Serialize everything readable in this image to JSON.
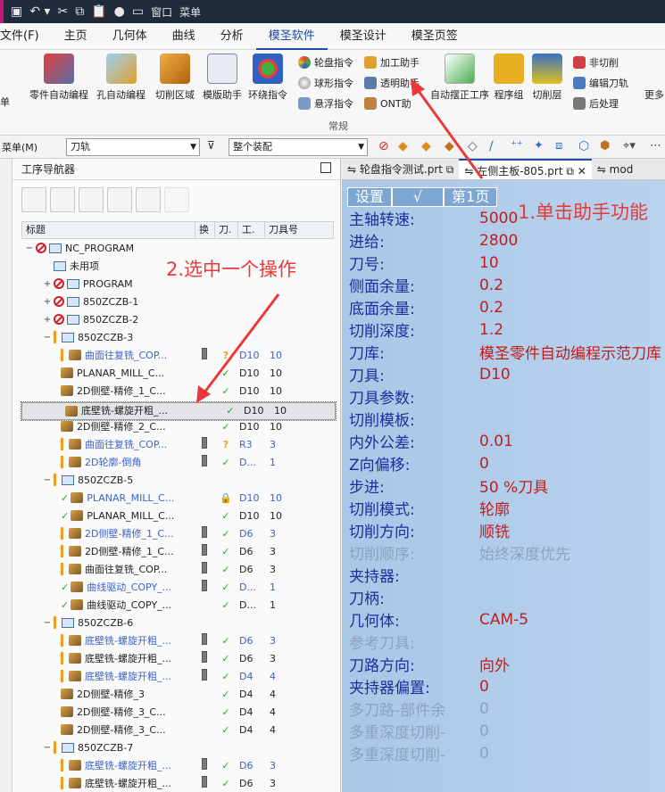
{
  "menubar": [
    "文件(F)",
    "主页",
    "几何体",
    "曲线",
    "分析",
    "模圣软件",
    "模圣设计",
    "模圣页签"
  ],
  "qat": {
    "window": "窗口",
    "menu": "菜单"
  },
  "ribbon": {
    "big": [
      "零件自动编程",
      "孔自动编程",
      "切削区域",
      "模版助手",
      "环绕指令"
    ],
    "small_col1": [
      "轮盘指令",
      "球形指令",
      "悬浮指令"
    ],
    "small_col2": [
      "加工助手",
      "透明助手",
      "ONT助"
    ],
    "big2": [
      "自动摆正工序",
      "程序组",
      "切削层"
    ],
    "small_col3": [
      "非切削",
      "编辑刀轨",
      "后处理"
    ],
    "group": "常规",
    "more": "更多",
    "left_partial": "单"
  },
  "filter": {
    "menu": "菜单(M)",
    "sel1": "刀轨",
    "sel2": "整个装配"
  },
  "navigator": {
    "title": "工序导航器",
    "columns": [
      "标题",
      "换",
      "刀.",
      "工.",
      "刀具号"
    ],
    "rows": [
      {
        "depth": 0,
        "kind": "folder-no",
        "title": "NC_PROGRAM",
        "exp": "−",
        "sw": "",
        "st": "",
        "tool": "",
        "num": ""
      },
      {
        "depth": 1,
        "kind": "folder",
        "title": "未用项",
        "exp": "",
        "sw": "",
        "st": "",
        "tool": "",
        "num": ""
      },
      {
        "depth": 1,
        "kind": "folder-no",
        "title": "PROGRAM",
        "exp": "+",
        "sw": "",
        "st": "",
        "tool": "",
        "num": ""
      },
      {
        "depth": 1,
        "kind": "folder-no",
        "title": "850ZCZB-1",
        "exp": "+",
        "sw": "",
        "st": "",
        "tool": "",
        "num": ""
      },
      {
        "depth": 1,
        "kind": "folder-no",
        "title": "850ZCZB-2",
        "exp": "+",
        "sw": "",
        "st": "",
        "tool": "",
        "num": ""
      },
      {
        "depth": 1,
        "kind": "folder-bar",
        "title": "850ZCZB-3",
        "exp": "−",
        "sw": "",
        "st": "",
        "tool": "",
        "num": ""
      },
      {
        "depth": 2,
        "kind": "op-bar",
        "title": "曲面往复铣_COP...",
        "color": "blue",
        "sw": "pen",
        "st": "?",
        "tool": "D10",
        "num": "10"
      },
      {
        "depth": 2,
        "kind": "op",
        "title": "PLANAR_MILL_C...",
        "color": "blk",
        "sw": "",
        "st": "✓",
        "tool": "D10",
        "num": "10"
      },
      {
        "depth": 2,
        "kind": "op",
        "title": "2D侧壁-精修_1_C...",
        "color": "blk",
        "sw": "",
        "st": "✓",
        "tool": "D10",
        "num": "10"
      },
      {
        "depth": 2,
        "kind": "op",
        "title": "底壁铣-螺旋开粗_...",
        "color": "blk",
        "sw": "",
        "st": "✓",
        "tool": "D10",
        "num": "10",
        "selected": true
      },
      {
        "depth": 2,
        "kind": "op",
        "title": "2D侧壁-精修_2_C...",
        "color": "blk",
        "sw": "",
        "st": "✓",
        "tool": "D10",
        "num": "10"
      },
      {
        "depth": 2,
        "kind": "op-bar",
        "title": "曲面往复铣_COP...",
        "color": "blue",
        "sw": "pen",
        "st": "?",
        "tool": "R3",
        "num": "3"
      },
      {
        "depth": 2,
        "kind": "op-bar",
        "title": "2D轮廓-倒角",
        "color": "blue",
        "sw": "pen",
        "st": "✓",
        "tool": "D...",
        "num": "1"
      },
      {
        "depth": 1,
        "kind": "folder-bar",
        "title": "850ZCZB-5",
        "exp": "−",
        "sw": "",
        "st": "",
        "tool": "",
        "num": ""
      },
      {
        "depth": 2,
        "kind": "op-chk",
        "title": "PLANAR_MILL_C...",
        "color": "blue",
        "sw": "",
        "st": "lock",
        "tool": "D10",
        "num": "10"
      },
      {
        "depth": 2,
        "kind": "op-chk",
        "title": "PLANAR_MILL_C...",
        "color": "blk",
        "sw": "",
        "st": "✓",
        "tool": "D10",
        "num": "10"
      },
      {
        "depth": 2,
        "kind": "op-bar",
        "title": "2D侧壁-精修_1_C...",
        "color": "blue",
        "sw": "pen",
        "st": "✓",
        "tool": "D6",
        "num": "3"
      },
      {
        "depth": 2,
        "kind": "op-bar",
        "title": "2D侧壁-精修_1_C...",
        "color": "blk",
        "sw": "pen",
        "st": "✓",
        "tool": "D6",
        "num": "3"
      },
      {
        "depth": 2,
        "kind": "op-bar",
        "title": "曲面往复铣_COP...",
        "color": "blk",
        "sw": "pen",
        "st": "✓",
        "tool": "D6",
        "num": "3"
      },
      {
        "depth": 2,
        "kind": "op-chk",
        "title": "曲线驱动_COPY_...",
        "color": "blue",
        "sw": "pen",
        "st": "✓",
        "tool": "D...",
        "num": "1"
      },
      {
        "depth": 2,
        "kind": "op-chk",
        "title": "曲线驱动_COPY_...",
        "color": "blk",
        "sw": "",
        "st": "✓",
        "tool": "D...",
        "num": "1"
      },
      {
        "depth": 1,
        "kind": "folder-bar",
        "title": "850ZCZB-6",
        "exp": "−",
        "sw": "",
        "st": "",
        "tool": "",
        "num": ""
      },
      {
        "depth": 2,
        "kind": "op-bar",
        "title": "底壁铣-螺旋开粗_...",
        "color": "blue",
        "sw": "pen",
        "st": "✓",
        "tool": "D6",
        "num": "3"
      },
      {
        "depth": 2,
        "kind": "op-bar",
        "title": "底壁铣-螺旋开粗_...",
        "color": "blk",
        "sw": "pen",
        "st": "✓",
        "tool": "D6",
        "num": "3"
      },
      {
        "depth": 2,
        "kind": "op-bar",
        "title": "底壁铣-螺旋开粗_...",
        "color": "blue",
        "sw": "pen",
        "st": "✓",
        "tool": "D4",
        "num": "4"
      },
      {
        "depth": 2,
        "kind": "op",
        "title": "2D侧壁-精修_3",
        "color": "blk",
        "sw": "",
        "st": "✓",
        "tool": "D4",
        "num": "4"
      },
      {
        "depth": 2,
        "kind": "op",
        "title": "2D侧壁-精修_3_C...",
        "color": "blk",
        "sw": "",
        "st": "✓",
        "tool": "D4",
        "num": "4"
      },
      {
        "depth": 2,
        "kind": "op",
        "title": "2D侧壁-精修_3_C...",
        "color": "blk",
        "sw": "",
        "st": "✓",
        "tool": "D4",
        "num": "4"
      },
      {
        "depth": 1,
        "kind": "folder-bar",
        "title": "850ZCZB-7",
        "exp": "−",
        "sw": "",
        "st": "",
        "tool": "",
        "num": ""
      },
      {
        "depth": 2,
        "kind": "op-bar",
        "title": "底壁铣-螺旋开粗_...",
        "color": "blue",
        "sw": "pen",
        "st": "✓",
        "tool": "D6",
        "num": "3"
      },
      {
        "depth": 2,
        "kind": "op-bar",
        "title": "底壁铣-螺旋开粗_...",
        "color": "blk",
        "sw": "pen",
        "st": "✓",
        "tool": "D6",
        "num": "3"
      }
    ]
  },
  "tabs": [
    "轮盘指令测试.prt",
    "左侧主板-805.prt",
    "mod"
  ],
  "panel": {
    "buttons": [
      "设置",
      "√",
      "第1页"
    ],
    "params": [
      {
        "label": "主轴转速:",
        "value": "5000"
      },
      {
        "label": "进给:",
        "value": "2800"
      },
      {
        "label": "刀号:",
        "value": "10"
      },
      {
        "label": "侧面余量:",
        "value": "0.2"
      },
      {
        "label": "底面余量:",
        "value": "0.2"
      },
      {
        "label": "切削深度:",
        "value": "1.2"
      },
      {
        "label": "刀库:",
        "value": "模圣零件自动编程示范刀库"
      },
      {
        "label": "刀具:",
        "value": "D10"
      },
      {
        "label": "刀具参数:",
        "value": ""
      },
      {
        "label": "切削模板:",
        "value": ""
      },
      {
        "label": "内外公差:",
        "value": "0.01"
      },
      {
        "label": "Z向偏移:",
        "value": "0"
      },
      {
        "label": "步进:",
        "value": "50 %刀具"
      },
      {
        "label": "切削模式:",
        "value": "轮廓"
      },
      {
        "label": "切削方向:",
        "value": "顺铣"
      },
      {
        "label": "切削顺序:",
        "value": "始终深度优先",
        "dim": true
      },
      {
        "label": "夹持器:",
        "value": ""
      },
      {
        "label": "刀柄:",
        "value": ""
      },
      {
        "label": "几何体:",
        "value": "CAM-5"
      },
      {
        "label": "参考刀具:",
        "value": "",
        "dim": true
      },
      {
        "label": "刀路方向:",
        "value": "向外"
      },
      {
        "label": "夹持器偏置:",
        "value": "0"
      },
      {
        "label": "多刀路-部件余",
        "value": "0",
        "dim": true
      },
      {
        "label": "多重深度切削-",
        "value": "0",
        "dim": true
      },
      {
        "label": "多重深度切削-",
        "value": "0",
        "dim": true
      }
    ]
  },
  "annotations": {
    "a1": "1.单击助手功能",
    "a2": "2.选中一个操作"
  }
}
